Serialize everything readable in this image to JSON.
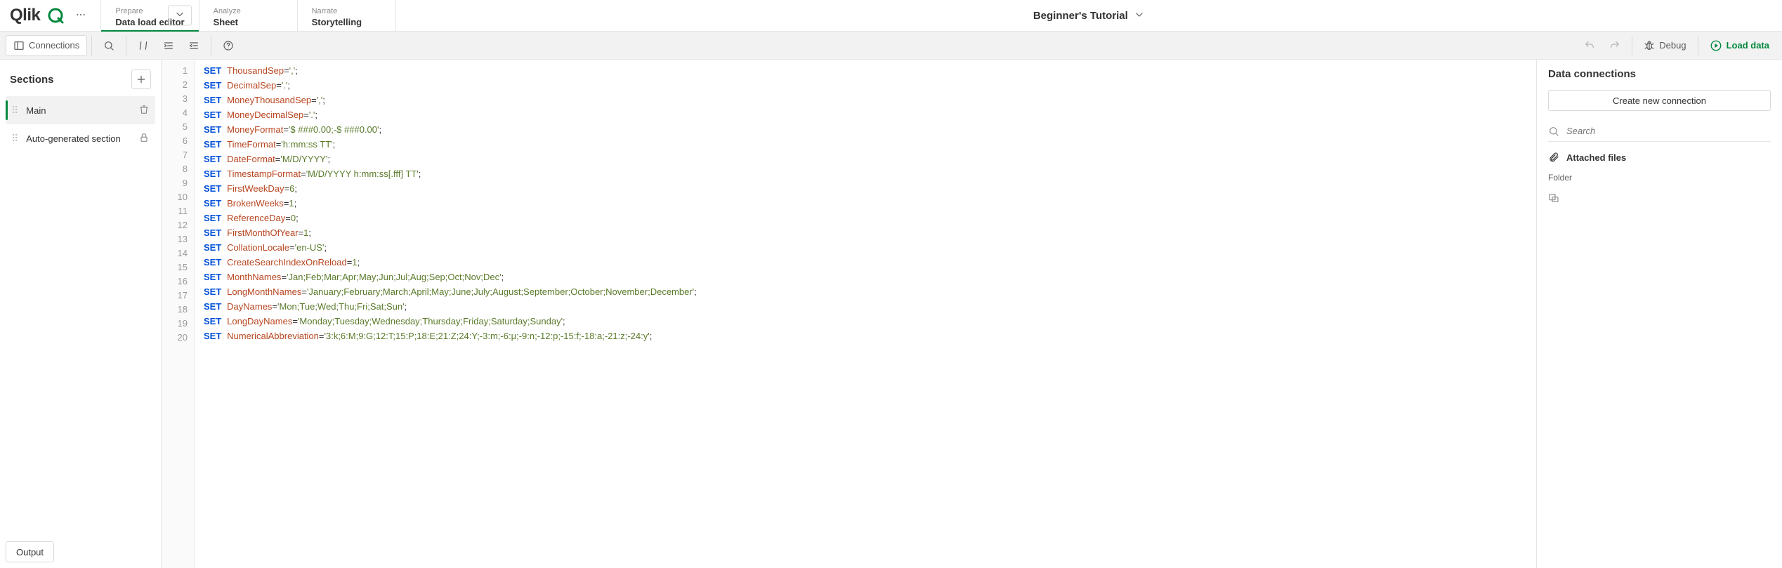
{
  "header": {
    "logo_text": "Qlik",
    "app_title": "Beginner's Tutorial",
    "tabs": [
      {
        "phase": "Prepare",
        "screen": "Data load editor"
      },
      {
        "phase": "Analyze",
        "screen": "Sheet"
      },
      {
        "phase": "Narrate",
        "screen": "Storytelling"
      }
    ]
  },
  "toolbar": {
    "connections_label": "Connections",
    "debug_label": "Debug",
    "load_data_label": "Load data"
  },
  "sections": {
    "title": "Sections",
    "items": [
      {
        "name": "Main"
      },
      {
        "name": "Auto-generated section"
      }
    ]
  },
  "code": {
    "lines": [
      {
        "kw": "SET",
        "var": "ThousandSep",
        "val_str": "','",
        "trail": ";"
      },
      {
        "kw": "SET",
        "var": "DecimalSep",
        "val_str": "'.'",
        "trail": ";"
      },
      {
        "kw": "SET",
        "var": "MoneyThousandSep",
        "val_str": "','",
        "trail": ";"
      },
      {
        "kw": "SET",
        "var": "MoneyDecimalSep",
        "val_str": "'.'",
        "trail": ";"
      },
      {
        "kw": "SET",
        "var": "MoneyFormat",
        "val_str": "'$ ###0.00;-$ ###0.00'",
        "trail": ";"
      },
      {
        "kw": "SET",
        "var": "TimeFormat",
        "val_str": "'h:mm:ss TT'",
        "trail": ";"
      },
      {
        "kw": "SET",
        "var": "DateFormat",
        "val_str": "'M/D/YYYY'",
        "trail": ";"
      },
      {
        "kw": "SET",
        "var": "TimestampFormat",
        "val_str": "'M/D/YYYY h:mm:ss[.fff] TT'",
        "trail": ";"
      },
      {
        "kw": "SET",
        "var": "FirstWeekDay",
        "val_num": "6",
        "trail": ";"
      },
      {
        "kw": "SET",
        "var": "BrokenWeeks",
        "val_num": "1",
        "trail": ";"
      },
      {
        "kw": "SET",
        "var": "ReferenceDay",
        "val_num": "0",
        "trail": ";"
      },
      {
        "kw": "SET",
        "var": "FirstMonthOfYear",
        "val_num": "1",
        "trail": ";"
      },
      {
        "kw": "SET",
        "var": "CollationLocale",
        "val_str": "'en-US'",
        "trail": ";"
      },
      {
        "kw": "SET",
        "var": "CreateSearchIndexOnReload",
        "val_num": "1",
        "trail": ";"
      },
      {
        "kw": "SET",
        "var": "MonthNames",
        "val_str": "'Jan;Feb;Mar;Apr;May;Jun;Jul;Aug;Sep;Oct;Nov;Dec'",
        "trail": ";"
      },
      {
        "kw": "SET",
        "var": "LongMonthNames",
        "val_str": "'January;February;March;April;May;June;July;August;September;October;November;December'",
        "trail": ";"
      },
      {
        "kw": "SET",
        "var": "DayNames",
        "val_str": "'Mon;Tue;Wed;Thu;Fri;Sat;Sun'",
        "trail": ";"
      },
      {
        "kw": "SET",
        "var": "LongDayNames",
        "val_str": "'Monday;Tuesday;Wednesday;Thursday;Friday;Saturday;Sunday'",
        "trail": ";"
      },
      {
        "kw": "SET",
        "var": "NumericalAbbreviation",
        "val_str": "'3:k;6:M;9:G;12:T;15:P;18:E;21:Z;24:Y;-3:m;-6:μ;-9:n;-12:p;-15:f;-18:a;-21:z;-24:y'",
        "trail": ";"
      }
    ],
    "extra_blank_lines": 1
  },
  "connections": {
    "title": "Data connections",
    "create_label": "Create new connection",
    "search_placeholder": "Search",
    "attached_label": "Attached files",
    "folder_label": "Folder"
  },
  "output": {
    "label": "Output"
  },
  "colors": {
    "brand_green": "#00873d"
  }
}
